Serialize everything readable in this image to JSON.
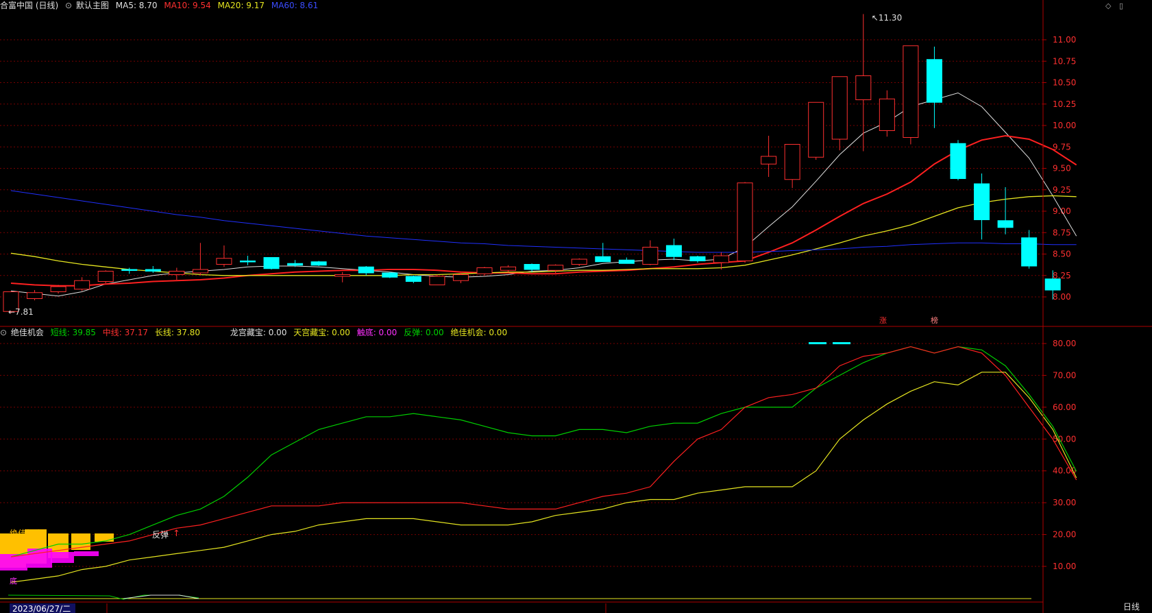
{
  "main_header": {
    "stock": "合富中国 (日线)",
    "view_label": "默认主图",
    "ma5": "MA5: 8.70",
    "ma10": "MA10: 9.54",
    "ma20": "MA20: 9.17",
    "ma60": "MA60: 8.61"
  },
  "indicator_header": {
    "name": "绝佳机会",
    "short_line": "短线: 39.85",
    "mid_line": "中线: 37.17",
    "long_line": "长线: 37.80",
    "longgong": "龙宫藏宝: 0.00",
    "tiangong": "天宫藏宝: 0.00",
    "chudi": "触底: 0.00",
    "fantan": "反弹: 0.00",
    "jiajia": "绝佳机会: 0.00"
  },
  "bottom_right_label": "日线",
  "date_label": "2023/06/27/二",
  "colors": {
    "up": "#ff3030",
    "down": "#00ffff",
    "ma5": "#e0e0e0",
    "ma10": "#ff2020",
    "ma20": "#e6e620",
    "ma60": "#2030ff",
    "short": "#00d000",
    "mid": "#ff2020",
    "long": "#e6e620",
    "grid": "#7a0000",
    "axis": "#b00000"
  },
  "chart_data": [
    {
      "type": "candlestick",
      "ylim": [
        7.8,
        11.35
      ],
      "y_ticks": [
        "8.00",
        "8.25",
        "8.50",
        "8.75",
        "9.00",
        "9.25",
        "9.50",
        "9.75",
        "10.00",
        "10.25",
        "10.50",
        "10.75",
        "11.00"
      ],
      "high_label": "11.30",
      "low_label": "7.81",
      "mark_zhang": "涨",
      "mark_bang": "榜",
      "ohlc": [
        [
          7.83,
          8.06,
          7.81,
          8.06
        ],
        [
          7.98,
          8.08,
          7.96,
          8.05
        ],
        [
          8.06,
          8.14,
          8.04,
          8.12
        ],
        [
          8.09,
          8.23,
          8.07,
          8.19
        ],
        [
          8.18,
          8.31,
          8.16,
          8.3
        ],
        [
          8.32,
          8.34,
          8.27,
          8.31
        ],
        [
          8.32,
          8.36,
          8.28,
          8.3
        ],
        [
          8.26,
          8.34,
          8.2,
          8.3
        ],
        [
          8.28,
          8.63,
          8.25,
          8.32
        ],
        [
          8.38,
          8.6,
          8.35,
          8.45
        ],
        [
          8.42,
          8.48,
          8.37,
          8.41
        ],
        [
          8.46,
          8.46,
          8.32,
          8.33
        ],
        [
          8.39,
          8.43,
          8.35,
          8.37
        ],
        [
          8.41,
          8.42,
          8.36,
          8.37
        ],
        [
          8.24,
          8.29,
          8.17,
          8.26
        ],
        [
          8.35,
          8.36,
          8.25,
          8.28
        ],
        [
          8.28,
          8.29,
          8.22,
          8.23
        ],
        [
          8.24,
          8.25,
          8.16,
          8.18
        ],
        [
          8.14,
          8.26,
          8.14,
          8.24
        ],
        [
          8.19,
          8.28,
          8.16,
          8.26
        ],
        [
          8.27,
          8.35,
          8.25,
          8.34
        ],
        [
          8.31,
          8.37,
          8.29,
          8.35
        ],
        [
          8.38,
          8.39,
          8.29,
          8.32
        ],
        [
          8.31,
          8.38,
          8.28,
          8.37
        ],
        [
          8.38,
          8.45,
          8.36,
          8.44
        ],
        [
          8.47,
          8.63,
          8.42,
          8.41
        ],
        [
          8.43,
          8.46,
          8.41,
          8.39
        ],
        [
          8.38,
          8.66,
          8.37,
          8.58
        ],
        [
          8.6,
          8.68,
          8.43,
          8.47
        ],
        [
          8.47,
          8.48,
          8.4,
          8.42
        ],
        [
          8.4,
          8.52,
          8.32,
          8.48
        ],
        [
          8.42,
          9.34,
          8.4,
          9.33
        ],
        [
          9.55,
          9.88,
          9.4,
          9.64
        ],
        [
          9.37,
          9.78,
          9.27,
          9.78
        ],
        [
          9.63,
          10.27,
          9.6,
          10.27
        ],
        [
          9.84,
          10.52,
          9.71,
          10.57
        ],
        [
          10.3,
          11.3,
          9.7,
          10.58
        ],
        [
          9.94,
          10.41,
          9.87,
          10.31
        ],
        [
          9.86,
          10.93,
          9.78,
          10.93
        ],
        [
          10.77,
          10.92,
          9.97,
          10.27
        ],
        [
          9.79,
          9.83,
          9.36,
          9.38
        ],
        [
          9.32,
          9.44,
          8.67,
          8.9
        ],
        [
          8.89,
          9.28,
          8.73,
          8.81
        ],
        [
          8.69,
          8.78,
          8.33,
          8.36
        ],
        [
          8.21,
          8.31,
          7.97,
          8.08
        ]
      ],
      "series": [
        {
          "name": "MA5",
          "values": [
            8.07,
            8.04,
            8.01,
            8.06,
            8.15,
            8.2,
            8.25,
            8.28,
            8.3,
            8.32,
            8.35,
            8.36,
            8.36,
            8.35,
            8.33,
            8.31,
            8.29,
            8.26,
            8.24,
            8.23,
            8.24,
            8.26,
            8.3,
            8.31,
            8.34,
            8.39,
            8.41,
            8.43,
            8.44,
            8.42,
            8.44,
            8.58,
            8.82,
            9.05,
            9.35,
            9.66,
            9.91,
            10.04,
            10.22,
            10.3,
            10.38,
            10.22,
            9.92,
            9.62,
            9.18,
            8.71
          ]
        },
        {
          "name": "MA10",
          "values": [
            8.16,
            8.14,
            8.13,
            8.13,
            8.15,
            8.16,
            8.18,
            8.19,
            8.2,
            8.22,
            8.25,
            8.27,
            8.29,
            8.3,
            8.31,
            8.31,
            8.32,
            8.32,
            8.31,
            8.29,
            8.28,
            8.28,
            8.27,
            8.27,
            8.29,
            8.3,
            8.31,
            8.33,
            8.35,
            8.38,
            8.4,
            8.42,
            8.52,
            8.63,
            8.78,
            8.94,
            9.09,
            9.2,
            9.34,
            9.55,
            9.71,
            9.83,
            9.88,
            9.84,
            9.72,
            9.54
          ]
        },
        {
          "name": "MA20",
          "values": [
            8.51,
            8.47,
            8.42,
            8.38,
            8.35,
            8.32,
            8.3,
            8.28,
            8.26,
            8.25,
            8.25,
            8.25,
            8.25,
            8.25,
            8.25,
            8.25,
            8.25,
            8.26,
            8.26,
            8.27,
            8.28,
            8.29,
            8.29,
            8.3,
            8.31,
            8.31,
            8.32,
            8.33,
            8.33,
            8.33,
            8.34,
            8.37,
            8.43,
            8.49,
            8.56,
            8.63,
            8.71,
            8.77,
            8.84,
            8.94,
            9.04,
            9.1,
            9.14,
            9.17,
            9.18,
            9.17
          ]
        },
        {
          "name": "MA60",
          "values": [
            9.24,
            9.2,
            9.16,
            9.12,
            9.08,
            9.04,
            9.0,
            8.96,
            8.93,
            8.89,
            8.86,
            8.83,
            8.8,
            8.77,
            8.74,
            8.71,
            8.69,
            8.67,
            8.65,
            8.63,
            8.62,
            8.6,
            8.59,
            8.58,
            8.57,
            8.56,
            8.55,
            8.54,
            8.53,
            8.52,
            8.52,
            8.52,
            8.53,
            8.54,
            8.55,
            8.56,
            8.58,
            8.59,
            8.61,
            8.62,
            8.63,
            8.63,
            8.62,
            8.62,
            8.61,
            8.61
          ]
        }
      ]
    },
    {
      "type": "line",
      "ylim": [
        0,
        85
      ],
      "y_ticks": [
        "10.00",
        "20.00",
        "30.00",
        "40.00",
        "50.00",
        "60.00",
        "70.00",
        "80.00"
      ],
      "signal_text_jiajia": "绝佳机会",
      "signal_text_fantan": "反弹",
      "signal_text_chu": "底",
      "series": [
        {
          "name": "短线",
          "values": [
            13,
            15,
            17,
            17,
            18,
            20,
            23,
            26,
            28,
            32,
            38,
            45,
            49,
            53,
            55,
            57,
            57,
            58,
            57,
            56,
            54,
            52,
            51,
            51,
            53,
            53,
            52,
            54,
            55,
            55,
            58,
            60,
            60,
            60,
            66,
            70,
            74,
            77,
            79,
            77,
            79,
            78,
            73,
            64,
            54,
            39.85
          ]
        },
        {
          "name": "中线",
          "values": [
            13,
            14,
            15,
            16,
            17,
            18,
            20,
            22,
            23,
            25,
            27,
            29,
            29,
            29,
            30,
            30,
            30,
            30,
            30,
            30,
            29,
            28,
            28,
            28,
            30,
            32,
            33,
            35,
            43,
            50,
            53,
            60,
            63,
            64,
            66,
            73,
            76,
            77,
            79,
            77,
            79,
            77,
            70,
            60,
            50,
            37.17
          ]
        },
        {
          "name": "长线",
          "values": [
            5,
            6,
            7,
            9,
            10,
            12,
            13,
            14,
            15,
            16,
            18,
            20,
            21,
            23,
            24,
            25,
            25,
            25,
            24,
            23,
            23,
            23,
            24,
            26,
            27,
            28,
            30,
            31,
            31,
            33,
            34,
            35,
            35,
            35,
            40,
            50,
            56,
            61,
            65,
            68,
            67,
            71,
            71,
            63,
            53,
            37.8
          ]
        }
      ]
    }
  ]
}
